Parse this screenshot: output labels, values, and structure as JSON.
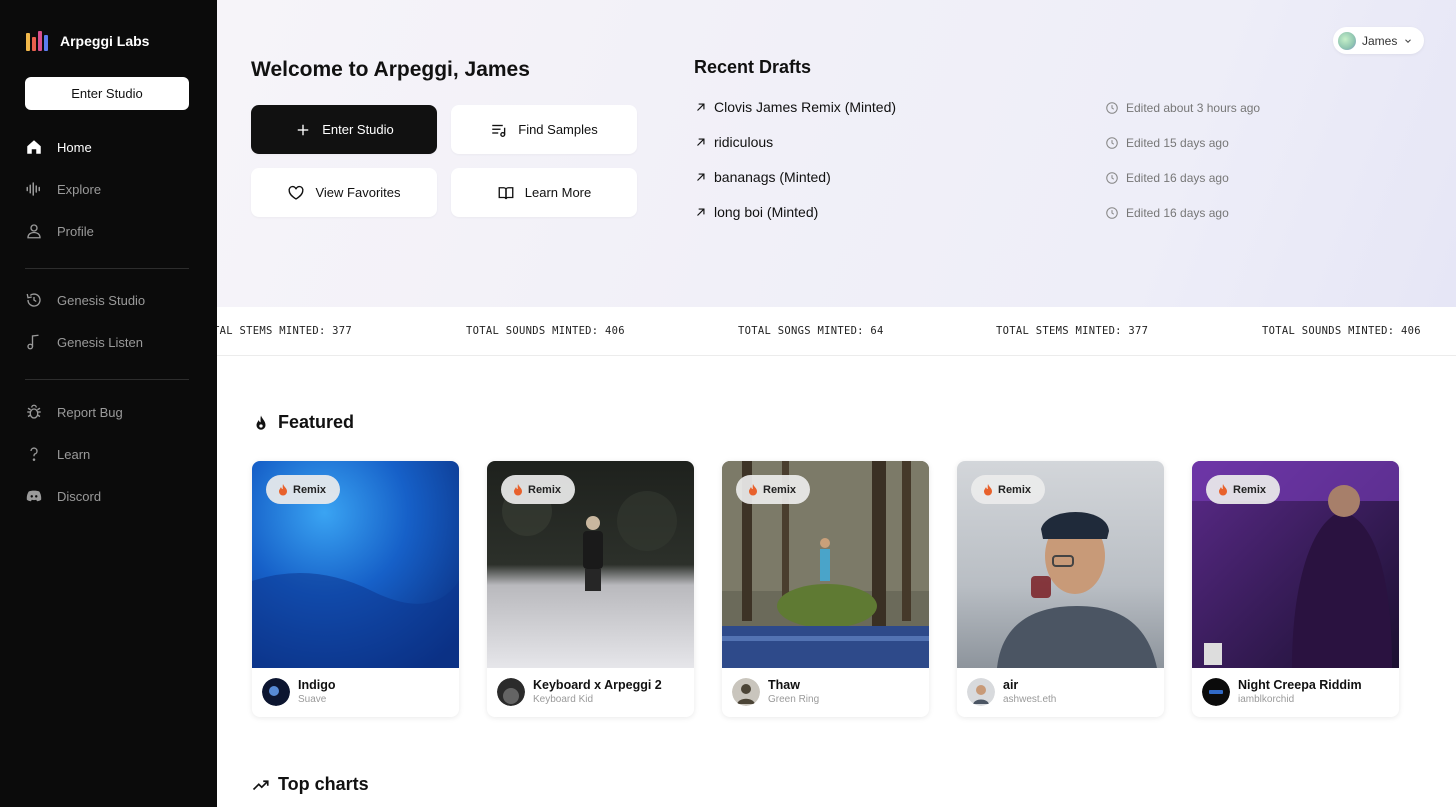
{
  "brand": {
    "name": "Arpeggi Labs"
  },
  "sidebar": {
    "enter_studio": "Enter Studio",
    "items": [
      {
        "label": "Home",
        "icon": "home-icon",
        "active": true
      },
      {
        "label": "Explore",
        "icon": "waveform-icon"
      },
      {
        "label": "Profile",
        "icon": "user-icon"
      },
      {
        "label": "Genesis Studio",
        "icon": "history-icon"
      },
      {
        "label": "Genesis Listen",
        "icon": "music-note-icon"
      },
      {
        "label": "Report Bug",
        "icon": "bug-icon"
      },
      {
        "label": "Learn",
        "icon": "question-icon"
      },
      {
        "label": "Discord",
        "icon": "discord-icon"
      }
    ]
  },
  "hero": {
    "welcome": "Welcome to Arpeggi, James",
    "buttons": {
      "enter_studio": "Enter Studio",
      "find_samples": "Find Samples",
      "view_favorites": "View Favorites",
      "learn_more": "Learn More"
    },
    "drafts_title": "Recent Drafts",
    "drafts": [
      {
        "name": "Clovis James Remix (Minted)",
        "edited": "Edited about 3 hours ago"
      },
      {
        "name": "ridiculous",
        "edited": "Edited 15 days ago"
      },
      {
        "name": "bananags (Minted)",
        "edited": "Edited 16 days ago"
      },
      {
        "name": "long boi (Minted)",
        "edited": "Edited 16 days ago"
      }
    ]
  },
  "user": {
    "name": "James"
  },
  "ticker": [
    "TAL STEMS MINTED: 377",
    "TOTAL SOUNDS MINTED: 406",
    "TOTAL SONGS MINTED: 64",
    "TOTAL STEMS MINTED: 377",
    "TOTAL SOUNDS MINTED: 406"
  ],
  "featured": {
    "title": "Featured",
    "badge": "Remix",
    "cards": [
      {
        "title": "Indigo",
        "artist": "Suave"
      },
      {
        "title": "Keyboard x Arpeggi 2",
        "artist": "Keyboard Kid"
      },
      {
        "title": "Thaw",
        "artist": "Green Ring"
      },
      {
        "title": "air",
        "artist": "ashwest.eth"
      },
      {
        "title": "Night Creepa Riddim",
        "artist": "iamblkorchid"
      }
    ]
  },
  "top_charts": {
    "title": "Top charts"
  },
  "colors": {
    "sidebar_bg": "#0b0b0b",
    "accent_dark": "#111111",
    "badge_flame": "#e8612c"
  }
}
